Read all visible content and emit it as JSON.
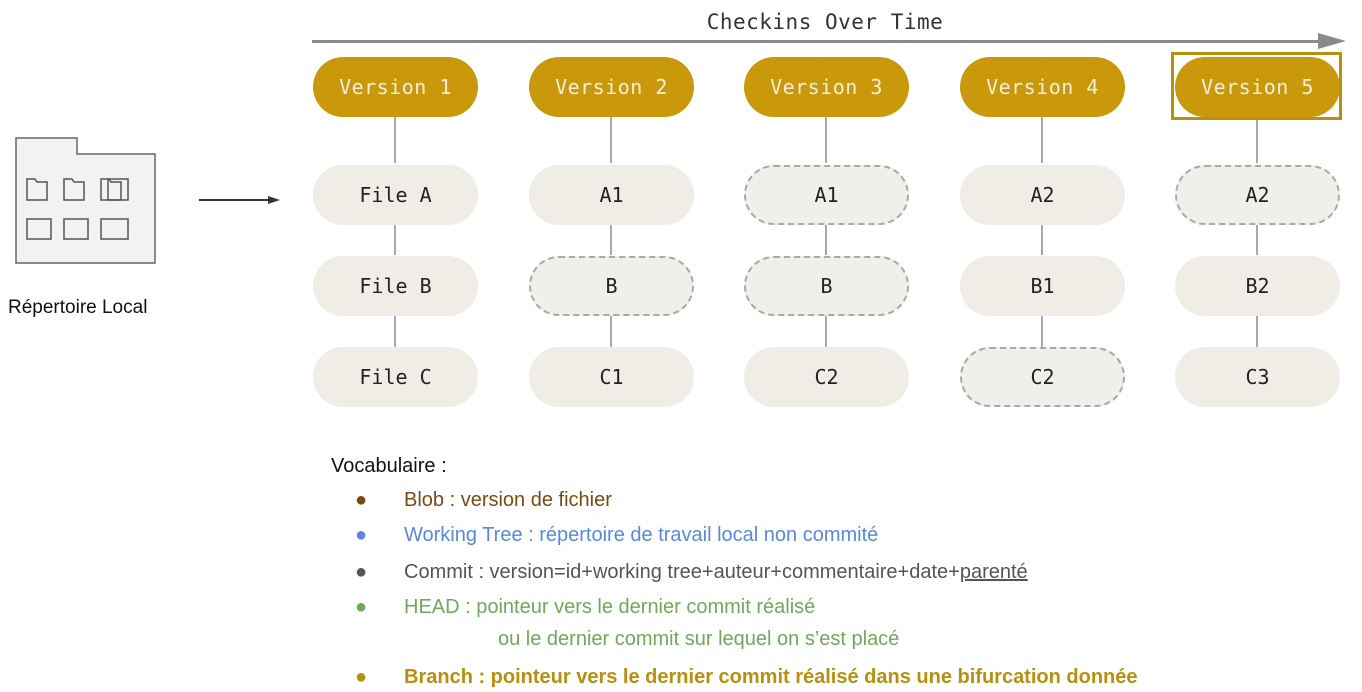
{
  "timeline": {
    "title": "Checkins Over Time"
  },
  "local_directory": {
    "label": "Répertoire Local"
  },
  "versions": [
    {
      "label": "Version 1",
      "files": [
        {
          "label": "File A",
          "style": "solid"
        },
        {
          "label": "File B",
          "style": "solid"
        },
        {
          "label": "File C",
          "style": "solid"
        }
      ]
    },
    {
      "label": "Version 2",
      "files": [
        {
          "label": "A1",
          "style": "solid"
        },
        {
          "label": "B",
          "style": "dashed"
        },
        {
          "label": "C1",
          "style": "solid"
        }
      ]
    },
    {
      "label": "Version 3",
      "files": [
        {
          "label": "A1",
          "style": "dashed"
        },
        {
          "label": "B",
          "style": "dashed"
        },
        {
          "label": "C2",
          "style": "solid"
        }
      ]
    },
    {
      "label": "Version 4",
      "files": [
        {
          "label": "A2",
          "style": "solid"
        },
        {
          "label": "B1",
          "style": "solid"
        },
        {
          "label": "C2",
          "style": "dashed"
        }
      ]
    },
    {
      "label": "Version 5",
      "highlighted": true,
      "files": [
        {
          "label": "A2",
          "style": "dashed"
        },
        {
          "label": "B2",
          "style": "solid"
        },
        {
          "label": "C3",
          "style": "solid"
        }
      ]
    }
  ],
  "vocabulary": {
    "title": "Vocabulaire :",
    "bullet": "●",
    "items": [
      {
        "text": "Blob : version de fichier",
        "color": "#7b4a12"
      },
      {
        "text": "Working Tree : répertoire de travail local non commité",
        "color": "#5b87de"
      },
      {
        "text": "Commit : version=id+working tree+auteur+commentaire+date+",
        "underlined": "parenté",
        "color": "#555555"
      },
      {
        "text": "HEAD : pointeur vers le dernier commit réalisé",
        "continuation": "ou le dernier commit sur lequel on s’est placé",
        "color": "#72a85b"
      },
      {
        "text": "Branch : pointeur vers le dernier commit réalisé dans une bifurcation donnée",
        "color": "#b8900f"
      }
    ]
  },
  "colors": {
    "version_fill": "#c9990b",
    "file_fill": "#efede6",
    "connector": "#a9a9a9",
    "timeline": "#8a8a8a"
  }
}
